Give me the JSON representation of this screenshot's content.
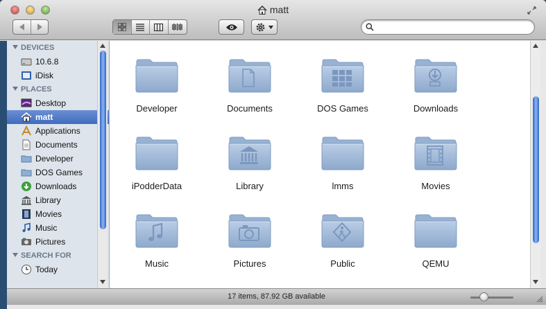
{
  "window": {
    "title": "matt"
  },
  "toolbar": {
    "view_modes": [
      "icon-view",
      "list-view",
      "column-view",
      "cover-flow-view"
    ],
    "active_view": "icon-view"
  },
  "search": {
    "placeholder": "",
    "value": ""
  },
  "sidebar": {
    "sections": [
      {
        "heading": "DEVICES",
        "items": [
          {
            "label": "10.6.8",
            "icon": "hard-drive-icon"
          },
          {
            "label": "iDisk",
            "icon": "idisk-icon"
          }
        ]
      },
      {
        "heading": "PLACES",
        "items": [
          {
            "label": "Desktop",
            "icon": "desktop-icon"
          },
          {
            "label": "matt",
            "icon": "home-icon",
            "selected": true
          },
          {
            "label": "Applications",
            "icon": "applications-icon"
          },
          {
            "label": "Documents",
            "icon": "documents-icon"
          },
          {
            "label": "Developer",
            "icon": "folder-icon"
          },
          {
            "label": "DOS Games",
            "icon": "folder-icon"
          },
          {
            "label": "Downloads",
            "icon": "downloads-icon"
          },
          {
            "label": "Library",
            "icon": "library-icon"
          },
          {
            "label": "Movies",
            "icon": "movies-icon"
          },
          {
            "label": "Music",
            "icon": "music-icon"
          },
          {
            "label": "Pictures",
            "icon": "pictures-icon"
          }
        ]
      },
      {
        "heading": "SEARCH FOR",
        "items": [
          {
            "label": "Today",
            "icon": "clock-icon"
          }
        ]
      }
    ]
  },
  "folders": [
    {
      "label": "Developer",
      "emblem": "none"
    },
    {
      "label": "Documents",
      "emblem": "document"
    },
    {
      "label": "DOS Games",
      "emblem": "grid"
    },
    {
      "label": "Downloads",
      "emblem": "download"
    },
    {
      "label": "iPodderData",
      "emblem": "none"
    },
    {
      "label": "Library",
      "emblem": "library"
    },
    {
      "label": "lmms",
      "emblem": "none"
    },
    {
      "label": "Movies",
      "emblem": "film"
    },
    {
      "label": "Music",
      "emblem": "music"
    },
    {
      "label": "Pictures",
      "emblem": "camera"
    },
    {
      "label": "Public",
      "emblem": "public"
    },
    {
      "label": "QEMU",
      "emblem": "none"
    }
  ],
  "status": {
    "text": "17 items, 87.92 GB available",
    "icon_size_level": 0.3
  },
  "colors": {
    "selection": "#4a74c4",
    "sidebar_bg": "#dde4eb",
    "folder": "#9fb8d6"
  }
}
